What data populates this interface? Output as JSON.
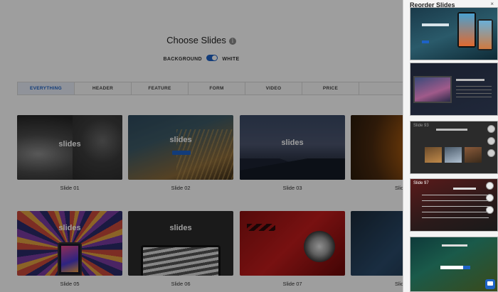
{
  "header": {
    "title": "Choose Slides",
    "info_icon": "info-icon"
  },
  "toggle": {
    "left_label": "BACKGROUND",
    "right_label": "WHITE",
    "state": "on",
    "accent": "#1e62c6"
  },
  "tabs": [
    {
      "label": "EVERYTHING",
      "active": true
    },
    {
      "label": "HEADER",
      "active": false
    },
    {
      "label": "FEATURE",
      "active": false
    },
    {
      "label": "FORM",
      "active": false
    },
    {
      "label": "VIDEO",
      "active": false
    },
    {
      "label": "PRICE",
      "active": false
    },
    {
      "label": "",
      "active": false
    }
  ],
  "slides": [
    {
      "label": "Slide 01",
      "brand": "slides"
    },
    {
      "label": "Slide 02",
      "brand": "slides"
    },
    {
      "label": "Slide 03",
      "brand": "slides"
    },
    {
      "label": "Slide"
    },
    {
      "label": "Slide 05",
      "brand": "slides"
    },
    {
      "label": "Slide 06",
      "brand": "slides"
    },
    {
      "label": "Slide 07",
      "brand": ""
    },
    {
      "label": "Slide"
    }
  ],
  "panel": {
    "title": "Reorder Slides",
    "close": "×",
    "thumb3_label": "Slide 93",
    "thumb4_label": "Slide 97"
  }
}
